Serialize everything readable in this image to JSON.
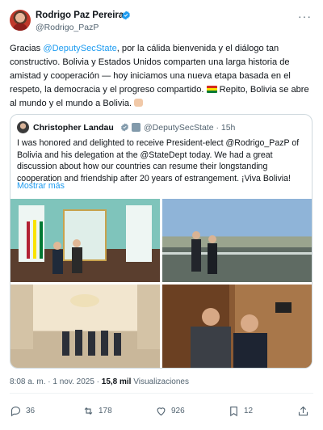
{
  "author": {
    "name": "Rodrigo Paz Pereira",
    "handle": "@Rodrigo_PazP"
  },
  "tweet": {
    "part1": "Gracias ",
    "mention": "@DeputySecState",
    "part2": ", por la cálida bienvenida y el diálogo tan constructivo. Bolivia y Estados Unidos comparten una larga historia de amistad y cooperación — hoy iniciamos una nueva etapa basada en el respeto, la democracia y el progreso compartido. ",
    "part3": " Repito, Bolivia se abre al mundo y el mundo a Bolivia. "
  },
  "quote": {
    "name": "Christopher Landau",
    "handle": "@DeputySecState · 15h",
    "text": "I was honored and delighted to receive President-elect @Rodrigo_PazP of Bolivia and his delegation at the @StateDept today. We had a great discussion about how our countries can resume their longstanding cooperation and friendship after 20 years of estrangement. ¡Viva Bolivia!",
    "show_more": "Mostrar más"
  },
  "meta": {
    "time": "8:08 a. m. · 1 nov. 2025 · ",
    "views_count": "15,8 mil",
    "views_label": " Visualizaciones"
  },
  "actions": {
    "replies": "36",
    "reposts": "178",
    "likes": "926",
    "bookmarks": "12"
  },
  "colors": {
    "accent": "#1d9bf0",
    "muted": "#536471",
    "text": "#0f1419"
  },
  "icons": [
    "verified-badge-icon",
    "more-icon",
    "reply-icon",
    "repost-icon",
    "like-icon",
    "bookmark-icon",
    "share-icon",
    "bolivia-flag-icon",
    "handshake-icon"
  ]
}
